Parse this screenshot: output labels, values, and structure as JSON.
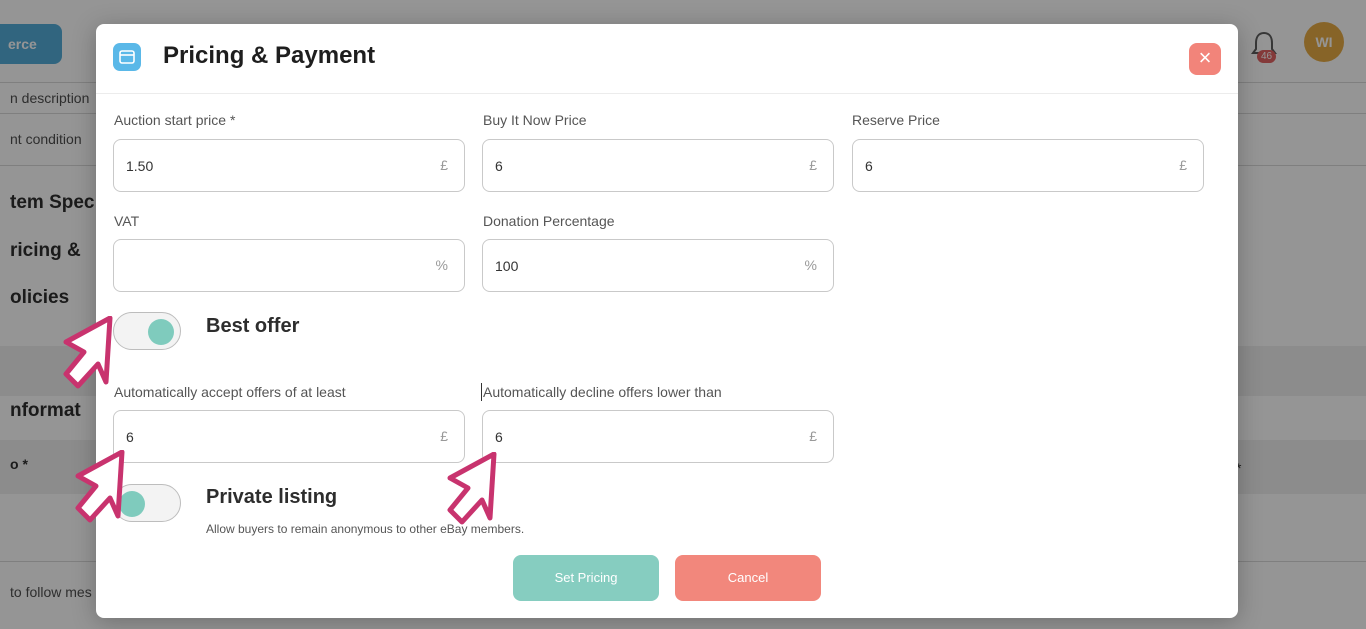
{
  "background": {
    "brand_label": "erce",
    "notification_count": "46",
    "avatar_initials": "WI",
    "rows": {
      "description": "n description",
      "condition": "nt condition",
      "follow": "to follow mes"
    },
    "sections": {
      "item_specifics": "tem Spec",
      "pricing": "ricing &",
      "policies": "olicies",
      "information": "nformat",
      "required_mark": "o *",
      "required_mark_right": "*"
    }
  },
  "modal": {
    "title": "Pricing & Payment",
    "header_icon": "card-icon",
    "close_icon": "close-icon",
    "close_symbol": "×",
    "fields": {
      "auction_start_price": {
        "label": "Auction start price *",
        "value": "1.50",
        "unit": "£"
      },
      "buy_it_now_price": {
        "label": "Buy It Now Price",
        "value": "6",
        "unit": "£"
      },
      "reserve_price": {
        "label": "Reserve Price",
        "value": "6",
        "unit": "£"
      },
      "vat": {
        "label": "VAT",
        "value": "",
        "unit": "%"
      },
      "donation_percentage": {
        "label": "Donation Percentage",
        "value": "100",
        "unit": "%"
      },
      "auto_accept": {
        "label": "Automatically accept offers of at least",
        "value": "6",
        "unit": "£"
      },
      "auto_decline": {
        "label": "Automatically decline offers lower than",
        "value": "6",
        "unit": "£"
      }
    },
    "best_offer": {
      "label": "Best offer",
      "enabled": true
    },
    "private_listing": {
      "label": "Private listing",
      "hint": "Allow buyers to remain anonymous to other eBay members.",
      "enabled": false
    },
    "buttons": {
      "set_pricing": "Set Pricing",
      "cancel": "Cancel"
    }
  },
  "colors": {
    "accent_teal": "#86cdc0",
    "cancel_red": "#f2877c",
    "icon_blue": "#5ab8e8",
    "pointer_magenta": "#c8336e"
  }
}
